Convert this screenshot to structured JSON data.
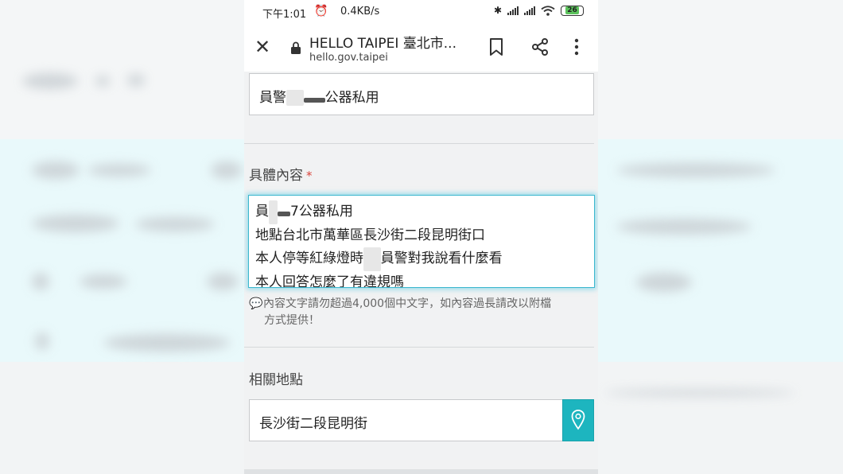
{
  "status_bar": {
    "time": "下午1:01",
    "network_speed": "0.4KB/s",
    "battery": "26"
  },
  "browser": {
    "page_title": "HELLO TAIPEI 臺北市...",
    "url": "hello.gov.taipei"
  },
  "form": {
    "subject_value": "員警公器私用",
    "subject_prefix": "員警",
    "subject_suffix": "公器私用",
    "content_label": "具體內容",
    "required_mark": "*",
    "content_lines": [
      "員警7公器私用",
      "地點台北市萬華區長沙街二段昆明街口",
      "本人停等紅綠燈時 員警對我說看什麼看",
      "本人回答怎麼了有違規嗎"
    ],
    "content_line1_prefix": "員",
    "content_line1_suffix": "7公器私用",
    "content_line3_prefix": "本人停等紅綠燈時",
    "content_line3_suffix": "員警對我說看什麼看",
    "hint_line1": "內容文字請勿超過4,000個中文字，如內容過長請改以附檔",
    "hint_line2": "方式提供！",
    "location_label": "相關地點",
    "location_value": "長沙街二段昆明街"
  }
}
